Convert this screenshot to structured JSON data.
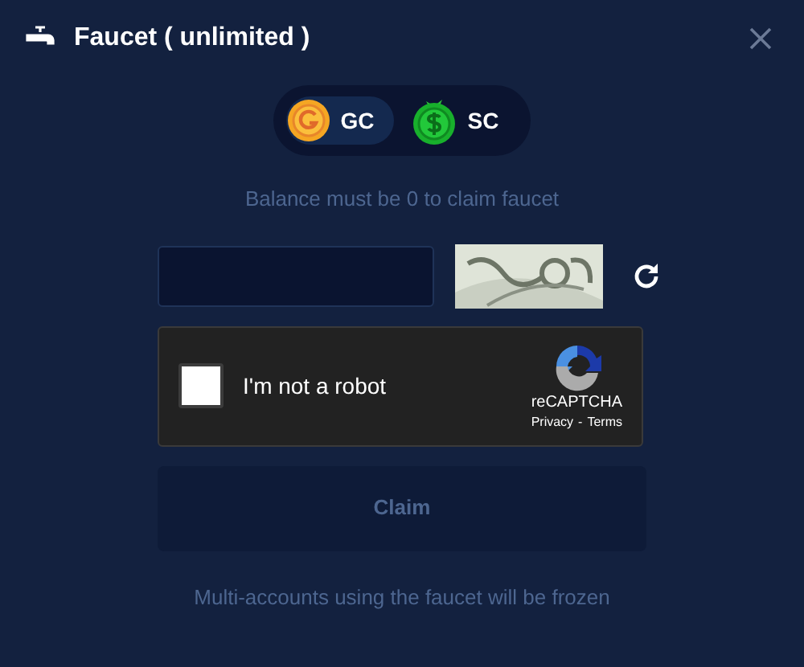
{
  "dialog": {
    "title": "Faucet ( unlimited )"
  },
  "currencies": [
    {
      "kind": "gold",
      "label": "GC",
      "selected": true
    },
    {
      "kind": "sweep",
      "label": "SC",
      "selected": false
    }
  ],
  "notice": "Balance must be 0 to claim faucet",
  "recaptcha": {
    "label": "I'm not a robot",
    "checked": false,
    "brand": "reCAPTCHA",
    "privacy": "Privacy",
    "separator": "-",
    "terms": "Terms"
  },
  "claim_button": {
    "label": "Claim",
    "disabled": true
  },
  "footer": "Multi-accounts using the faucet will be frozen"
}
